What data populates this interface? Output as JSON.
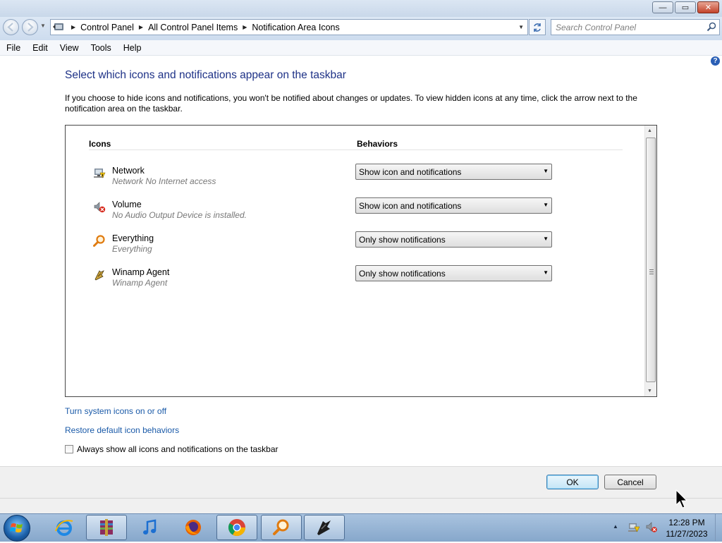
{
  "window": {
    "minimize_label": "—",
    "maximize_label": "▭",
    "close_label": "✕"
  },
  "address": {
    "crumbs": [
      "Control Panel",
      "All Control Panel Items",
      "Notification Area Icons"
    ]
  },
  "search": {
    "placeholder": "Search Control Panel"
  },
  "menu": {
    "items": [
      "File",
      "Edit",
      "View",
      "Tools",
      "Help"
    ]
  },
  "content": {
    "title": "Select which icons and notifications appear on the taskbar",
    "description": "If you choose to hide icons and notifications, you won't be notified about changes or updates. To view hidden icons at any time, click the arrow next to the notification area on the taskbar.",
    "columns": {
      "icons": "Icons",
      "behaviors": "Behaviors"
    },
    "rows": [
      {
        "name": "Network",
        "sub": "Network No Internet access",
        "behavior": "Show icon and notifications",
        "icon": "network-icon"
      },
      {
        "name": "Volume",
        "sub": "No Audio Output Device is installed.",
        "behavior": "Show icon and notifications",
        "icon": "volume-muted-icon"
      },
      {
        "name": "Everything",
        "sub": "Everything",
        "behavior": "Only show notifications",
        "icon": "everything-search-icon"
      },
      {
        "name": "Winamp Agent",
        "sub": "Winamp Agent",
        "behavior": "Only show notifications",
        "icon": "winamp-icon"
      }
    ],
    "links": {
      "system_icons": "Turn system icons on or off",
      "restore": "Restore default icon behaviors"
    },
    "checkbox": {
      "label": "Always show all icons and notifications on the taskbar",
      "checked": false
    }
  },
  "footer": {
    "ok": "OK",
    "cancel": "Cancel"
  },
  "taskbar": {
    "apps": [
      "internet-explorer-icon",
      "winrar-icon",
      "itunes-icon",
      "firefox-icon",
      "chrome-icon",
      "everything-icon",
      "winamp-icon"
    ],
    "clock_time": "12:28 PM",
    "clock_date": "11/27/2023"
  },
  "colors": {
    "title_blue": "#1e3287",
    "link_blue": "#1a5aa8"
  }
}
